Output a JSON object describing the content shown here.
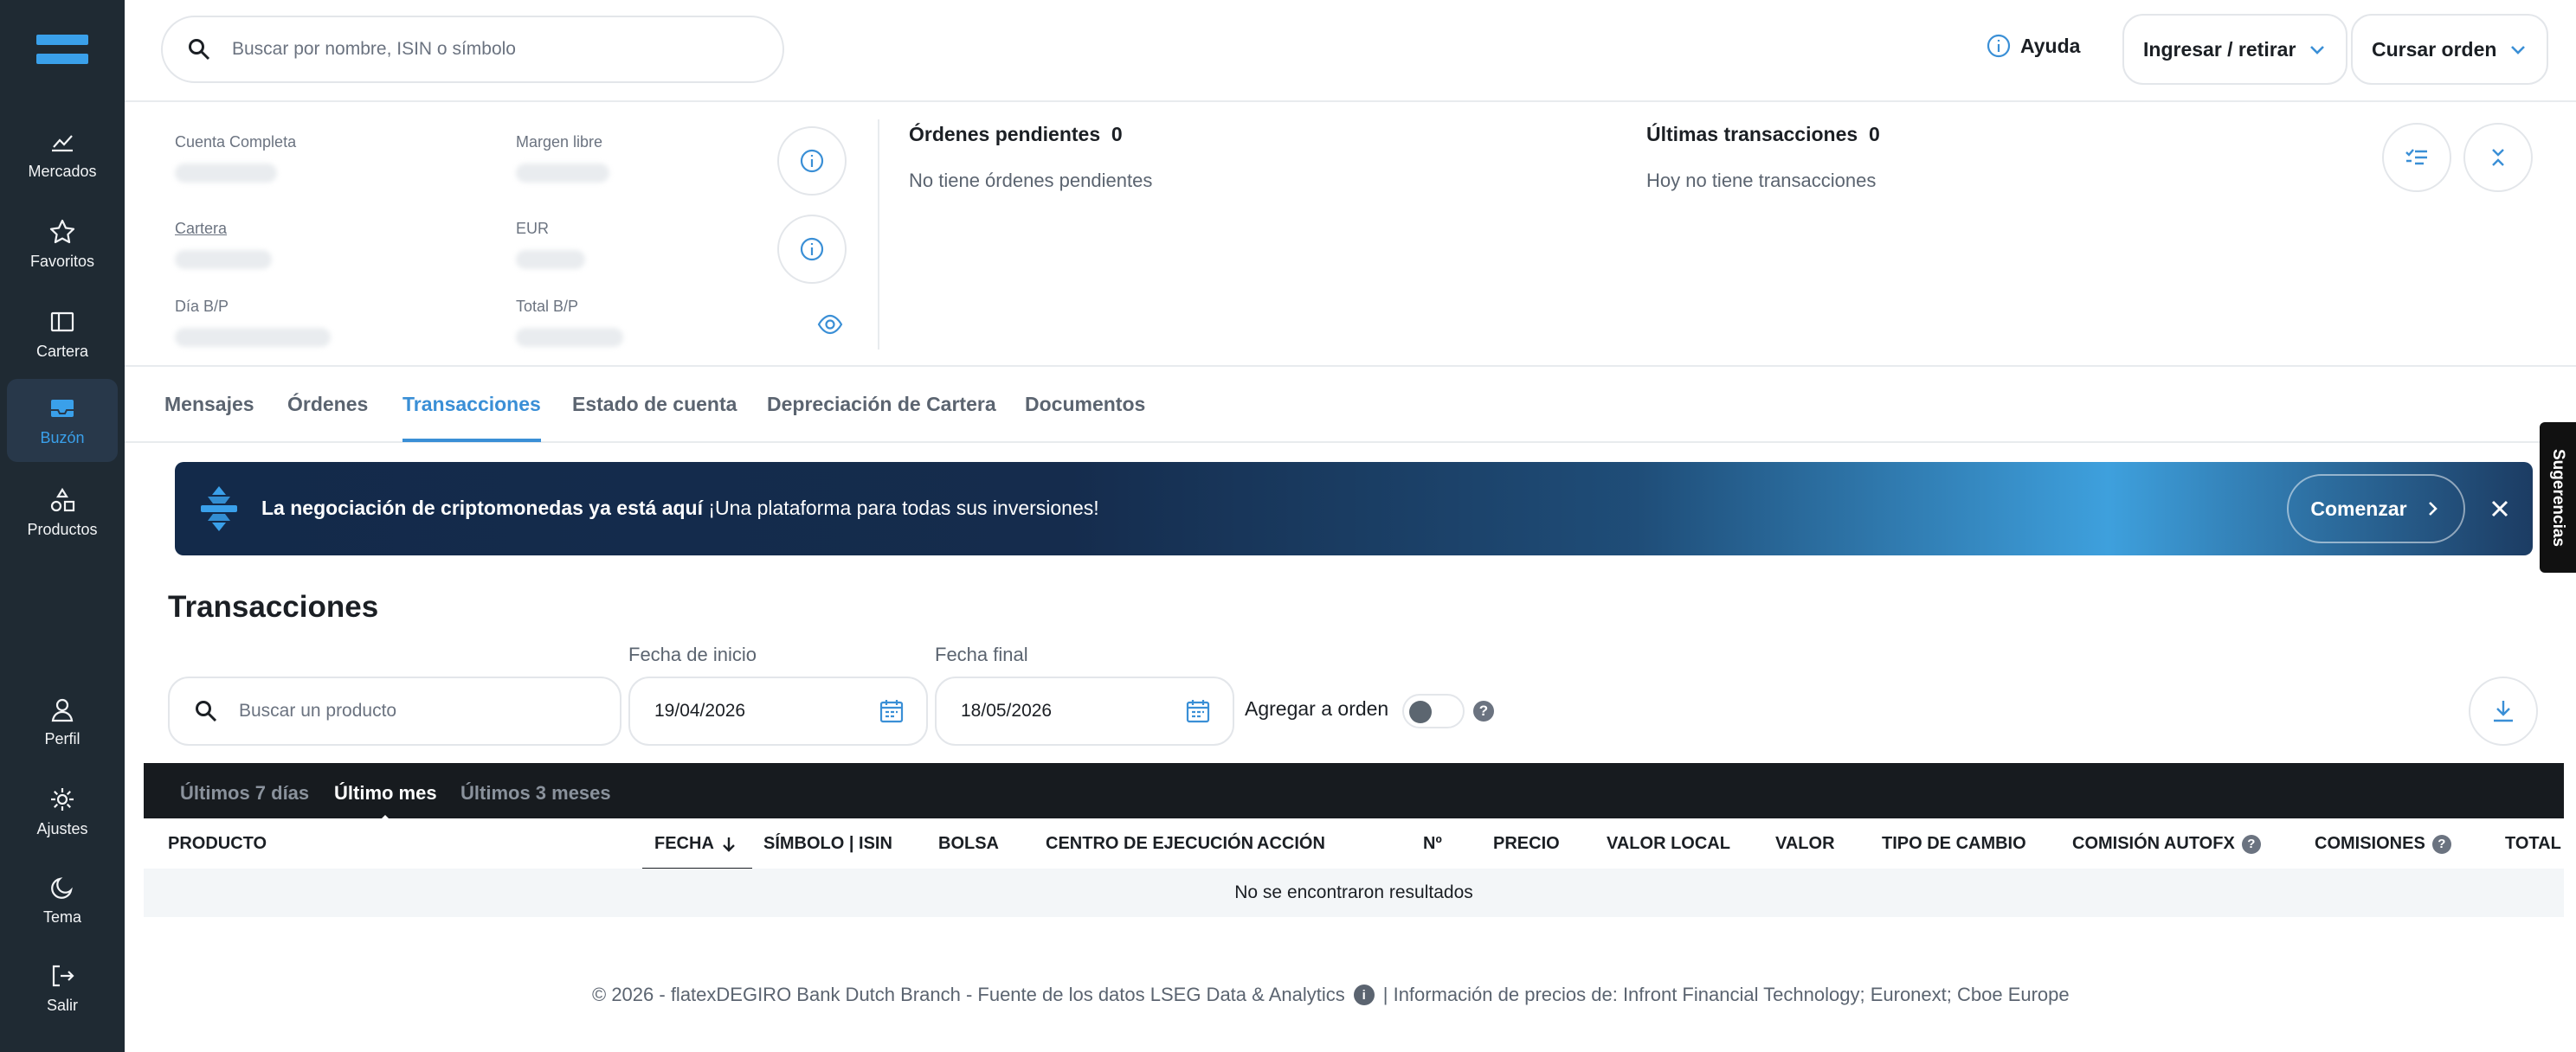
{
  "sidebar": {
    "items": [
      {
        "label": "Mercados",
        "icon": "chart-icon"
      },
      {
        "label": "Favoritos",
        "icon": "star-icon"
      },
      {
        "label": "Cartera",
        "icon": "portfolio-icon"
      },
      {
        "label": "Buzón",
        "icon": "inbox-icon",
        "active": true
      },
      {
        "label": "Productos",
        "icon": "products-icon"
      },
      {
        "label": "Perfil",
        "icon": "user-icon"
      },
      {
        "label": "Ajustes",
        "icon": "gear-icon"
      },
      {
        "label": "Tema",
        "icon": "theme-icon"
      },
      {
        "label": "Salir",
        "icon": "logout-icon"
      }
    ]
  },
  "topbar": {
    "search_placeholder": "Buscar por nombre, ISIN o símbolo",
    "help_label": "Ayuda",
    "deposit_label": "Ingresar / retirar",
    "order_label": "Cursar orden"
  },
  "summary": {
    "cuenta_completa": "Cuenta Completa",
    "margen_libre": "Margen libre",
    "cartera": "Cartera",
    "eur": "EUR",
    "dia_bp": "Día B/P",
    "total_bp": "Total B/P",
    "pending_title": "Órdenes pendientes",
    "pending_count": "0",
    "pending_text": "No tiene órdenes pendientes",
    "last_title": "Últimas transacciones",
    "last_count": "0",
    "last_text": "Hoy no tiene transacciones"
  },
  "tabs": [
    {
      "label": "Mensajes"
    },
    {
      "label": "Órdenes"
    },
    {
      "label": "Transacciones",
      "active": true
    },
    {
      "label": "Estado de cuenta"
    },
    {
      "label": "Depreciación de Cartera"
    },
    {
      "label": "Documentos"
    }
  ],
  "banner": {
    "bold_text": "La negociación de criptomonedas ya está aquí",
    "text": "¡Una plataforma para todas sus inversiones!",
    "cta": "Comenzar"
  },
  "feedback_label": "Sugerencias",
  "transactions": {
    "title": "Transacciones",
    "product_placeholder": "Buscar un producto",
    "start_label": "Fecha de inicio",
    "start_value": "19/04/2026",
    "end_label": "Fecha final",
    "end_value": "18/05/2026",
    "aggregate_label": "Agregar a orden",
    "aggregate_on": false,
    "periods": [
      {
        "label": "Últimos 7 días"
      },
      {
        "label": "Último mes",
        "active": true
      },
      {
        "label": "Últimos 3 meses"
      }
    ],
    "columns": [
      "PRODUCTO",
      "FECHA",
      "SÍMBOLO | ISIN",
      "BOLSA",
      "CENTRO DE EJECUCIÓN",
      "ACCIÓN",
      "Nº",
      "PRECIO",
      "VALOR LOCAL",
      "VALOR",
      "TIPO DE CAMBIO",
      "COMISIÓN AUTOFX",
      "COMISIONES",
      "TOTAL"
    ],
    "empty_text": "No se encontraron resultados"
  },
  "footer": {
    "left": "© 2026 - flatexDEGIRO Bank Dutch Branch - Fuente de los datos LSEG Data & Analytics",
    "right": "| Información de precios de: Infront Financial Technology; Euronext; Cboe Europe"
  },
  "colors": {
    "accent": "#3a8fd6",
    "sidebar": "#1f2a33",
    "period_bar": "#171b1f"
  }
}
